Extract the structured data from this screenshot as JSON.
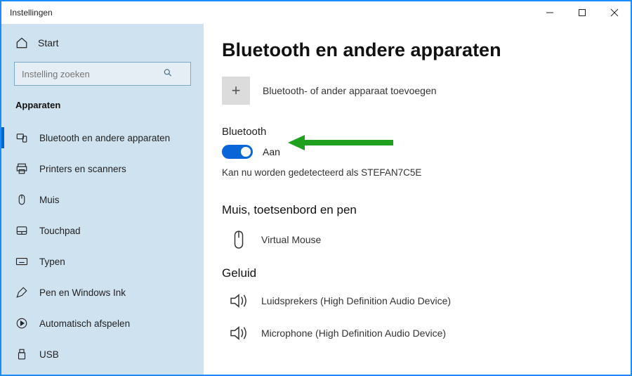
{
  "window": {
    "title": "Instellingen"
  },
  "sidebar": {
    "home": "Start",
    "search_placeholder": "Instelling zoeken",
    "section": "Apparaten",
    "items": [
      {
        "label": "Bluetooth en andere apparaten",
        "icon": "bluetooth-devices-icon",
        "active": true
      },
      {
        "label": "Printers en scanners",
        "icon": "printer-icon"
      },
      {
        "label": "Muis",
        "icon": "mouse-icon"
      },
      {
        "label": "Touchpad",
        "icon": "touchpad-icon"
      },
      {
        "label": "Typen",
        "icon": "keyboard-icon"
      },
      {
        "label": "Pen en Windows Ink",
        "icon": "pen-icon"
      },
      {
        "label": "Automatisch afspelen",
        "icon": "autoplay-icon"
      },
      {
        "label": "USB",
        "icon": "usb-icon"
      }
    ]
  },
  "main": {
    "heading": "Bluetooth en andere apparaten",
    "add_label": "Bluetooth- of ander apparaat toevoegen",
    "bluetooth": {
      "label": "Bluetooth",
      "state": "Aan",
      "status": "Kan nu worden gedetecteerd als STEFAN7C5E"
    },
    "groups": [
      {
        "title": "Muis, toetsenbord en pen",
        "devices": [
          {
            "label": "Virtual Mouse",
            "icon": "mouse-icon"
          }
        ]
      },
      {
        "title": "Geluid",
        "devices": [
          {
            "label": "Luidsprekers (High Definition Audio Device)",
            "icon": "speaker-icon"
          },
          {
            "label": "Microphone (High Definition Audio Device)",
            "icon": "speaker-icon"
          }
        ]
      }
    ]
  }
}
